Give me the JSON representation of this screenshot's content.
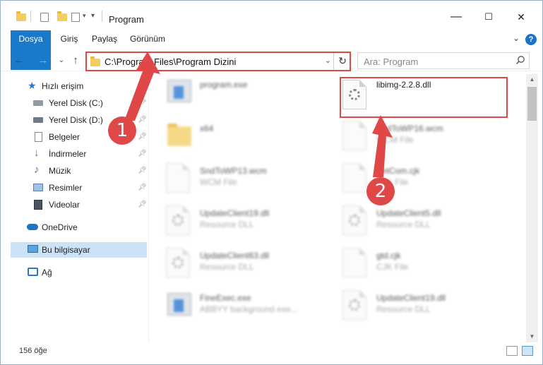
{
  "window": {
    "title": "Program",
    "controls": {
      "minimize": "—",
      "maximize": "☐",
      "close": "✕"
    }
  },
  "ribbon": {
    "tabs": [
      "Dosya",
      "Giriş",
      "Paylaş",
      "Görünüm"
    ],
    "help": "?"
  },
  "nav": {
    "address": "C:\\Program Files\\Program Dizini",
    "search_placeholder": "Ara: Program"
  },
  "sidebar": {
    "items": [
      {
        "label": "Hızlı erişim",
        "icon": "star-icon",
        "pinned": false
      },
      {
        "label": "Yerel Disk (C:)",
        "icon": "drive-icon",
        "pinned": true
      },
      {
        "label": "Yerel Disk (D:)",
        "icon": "drive-icon",
        "pinned": true
      },
      {
        "label": "Belgeler",
        "icon": "document-icon",
        "pinned": true
      },
      {
        "label": "İndirmeler",
        "icon": "download-icon",
        "pinned": true
      },
      {
        "label": "Müzik",
        "icon": "music-icon",
        "pinned": true
      },
      {
        "label": "Resimler",
        "icon": "pictures-icon",
        "pinned": true
      },
      {
        "label": "Videolar",
        "icon": "video-icon",
        "pinned": true
      },
      {
        "label": "OneDrive",
        "icon": "cloud-icon",
        "pinned": false
      },
      {
        "label": "Bu bilgisayar",
        "icon": "computer-icon",
        "pinned": false,
        "selected": true
      },
      {
        "label": "Ağ",
        "icon": "network-icon",
        "pinned": false
      }
    ]
  },
  "files": [
    {
      "name": "program.exe",
      "type": "",
      "icon": "exe-icon",
      "blurred": true
    },
    {
      "name": "libimg-2.2.8.dll",
      "type": "",
      "icon": "dll-icon",
      "blurred": false,
      "highlighted": true
    },
    {
      "name": "x64",
      "type": "",
      "icon": "folder-icon",
      "blurred": true
    },
    {
      "name": "SndToWP16.wcm",
      "type": "WCM File",
      "icon": "file-icon",
      "blurred": true
    },
    {
      "name": "SndToWP13.wcm",
      "type": "WCM File",
      "icon": "file-icon",
      "blurred": true
    },
    {
      "name": "SetCom.cjk",
      "type": "CJK File",
      "icon": "file-icon",
      "blurred": true
    },
    {
      "name": "UpdateClient19.dll",
      "type": "Resource DLL",
      "icon": "dll-icon",
      "blurred": true
    },
    {
      "name": "UpdateClient5.dll",
      "type": "Resource DLL",
      "icon": "dll-icon",
      "blurred": true
    },
    {
      "name": "UpdateClient63.dll",
      "type": "Resource DLL",
      "icon": "dll-icon",
      "blurred": true
    },
    {
      "name": "gtd.cjk",
      "type": "CJK File",
      "icon": "file-icon",
      "blurred": true
    },
    {
      "name": "FineExec.exe",
      "type": "ABBYY background exe...",
      "icon": "exe-icon",
      "blurred": true
    },
    {
      "name": "UpdateClient19.dll",
      "type": "Resource DLL",
      "icon": "dll-icon",
      "blurred": true
    }
  ],
  "status": {
    "count": "156 öğe"
  },
  "annotations": {
    "step1": "1",
    "step2": "2",
    "color": "#e04848"
  }
}
